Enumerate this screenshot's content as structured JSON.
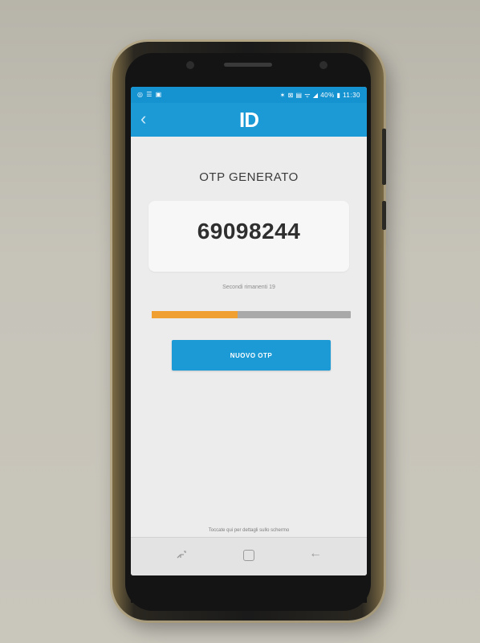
{
  "status_bar": {
    "left_icons": "◎ ☰ ▣",
    "right_text": "✶ ⊠ ▤ ᯤ ◢ 40% ▮ 11:30"
  },
  "app_bar": {
    "logo_text": "ID",
    "back_icon": "chevron-left-icon"
  },
  "otp": {
    "title": "OTP GENERATO",
    "code": "69098244",
    "countdown_text": "Secondi rimanenti 19",
    "progress": 0.43,
    "progress_color": "#f0a030",
    "new_button_label": "NUOVO OTP"
  },
  "hint_text": "Toccate qui per dettagli sullo schermo",
  "nav_bar": {
    "recent_icon": "recent-apps-icon",
    "home_icon": "home-icon",
    "back_icon": "back-arrow-icon"
  },
  "colors": {
    "accent": "#1b9ad6",
    "status_bar": "#1593d1",
    "screen_bg": "#ececec"
  }
}
